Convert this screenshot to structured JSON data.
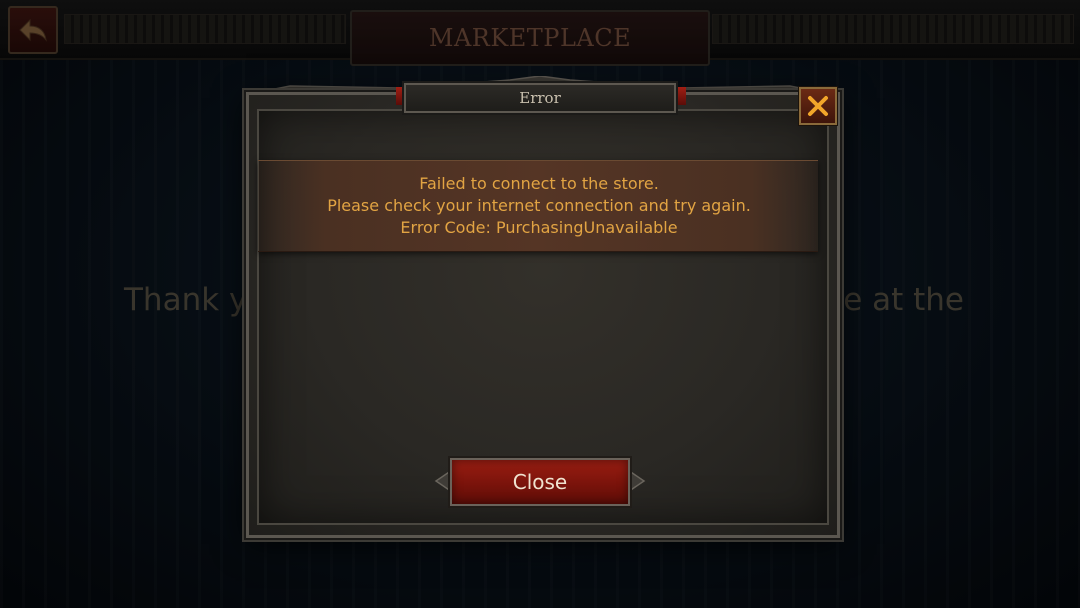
{
  "header": {
    "title": "MARKETPLACE",
    "back_icon": "back-arrow-icon"
  },
  "background": {
    "message_left": "Thank y",
    "message_right": "e at the"
  },
  "dialog": {
    "title": "Error",
    "close_icon": "close-x-icon",
    "message_lines": [
      "Failed to connect to the store.",
      "Please check your internet connection and try again.",
      "Error Code: PurchasingUnavailable"
    ],
    "close_button_label": "Close"
  },
  "colors": {
    "message_text": "#e2a443",
    "button_red": "#8a160d",
    "title_text": "#c9c0ae"
  }
}
